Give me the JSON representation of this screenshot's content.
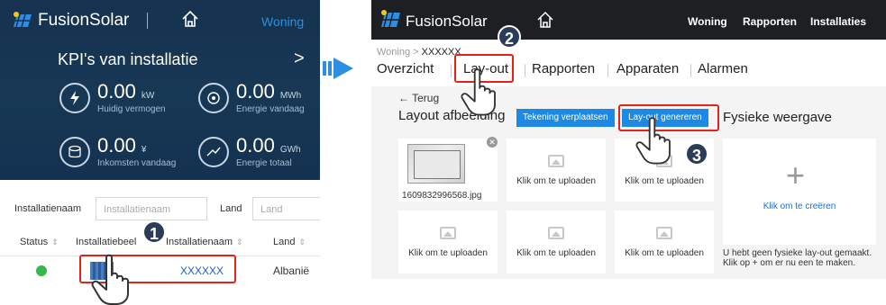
{
  "left_app": {
    "brand": "FusionSolar",
    "header_link": "Woning",
    "kpi_title": "KPI's van installatie",
    "kpi_arrow": ">",
    "kpis": [
      {
        "value": "0.00",
        "unit": "kW",
        "label": "Huidig vermogen",
        "icon": "lightning-icon"
      },
      {
        "value": "0.00",
        "unit": "MWh",
        "label": "Energie vandaag",
        "icon": "energy-today-icon"
      },
      {
        "value": "0.00",
        "unit": "¥",
        "label": "Inkomsten vandaag",
        "icon": "coins-icon"
      },
      {
        "value": "0.00",
        "unit": "GWh",
        "label": "Energie totaal",
        "icon": "energy-total-icon"
      }
    ],
    "filter": {
      "name_label": "Installatienaam",
      "name_placeholder": "Installatienaam",
      "country_label": "Land",
      "country_placeholder": "Land"
    },
    "table": {
      "headers": [
        "Status",
        "Installatiebeel",
        "Installatienaam",
        "Land"
      ],
      "row": {
        "status_color": "#34b84a",
        "name": "XXXXXX",
        "country": "Albanië"
      }
    },
    "step_badge": "1"
  },
  "right_app": {
    "brand": "FusionSolar",
    "nav": [
      "Woning",
      "Rapporten",
      "Installaties"
    ],
    "breadcrumb": {
      "parent": "Woning",
      "separator": ">",
      "current": "XXXXXX"
    },
    "tabs": [
      "Overzicht",
      "Lay-out",
      "Rapporten",
      "Apparaten",
      "Alarmen"
    ],
    "back_label": "← Terug",
    "layout_title": "Layout afbeelding",
    "btn_move": "Tekening verplaatsen",
    "btn_generate": "Lay-out genereren",
    "physical_title": "Fysieke weergave",
    "photo_filename": "1609832996568.jpg",
    "upload_label": "Klik om te uploaden",
    "create_label": "Klik om te creëren",
    "empty_message_1": "U hebt geen fysieke lay-out gemaakt.",
    "empty_message_2": "Klik op + om er nu een te maken.",
    "step_badges": [
      "2",
      "3"
    ]
  },
  "colors": {
    "accent_blue": "#1e88e5",
    "highlight_red": "#e2231a",
    "status_green": "#34b84a",
    "header_dark": "#1d1f22",
    "mobile_bg": "#16324f"
  }
}
